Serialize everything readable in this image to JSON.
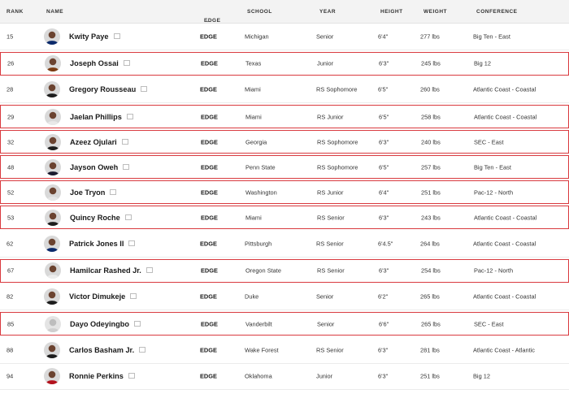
{
  "headers": {
    "rank": "RANK",
    "name": "NAME",
    "position": "EDGE",
    "school": "SCHOOL",
    "year": "YEAR",
    "height": "HEIGHT",
    "weight": "WEIGHT",
    "conference": "CONFERENCE"
  },
  "sort_icon": "chevron-down-icon",
  "highlight_color": "#d93a3f",
  "rows": [
    {
      "rank": "15",
      "name": "Kwity Paye",
      "position": "EDGE",
      "school": "Michigan",
      "year": "Senior",
      "height": "6'4\"",
      "weight": "277 lbs",
      "conference": "Big Ten - East",
      "highlighted": false,
      "jersey": "#0b2a6b"
    },
    {
      "rank": "26",
      "name": "Joseph Ossai",
      "position": "EDGE",
      "school": "Texas",
      "year": "Junior",
      "height": "6'3\"",
      "weight": "245 lbs",
      "conference": "Big 12",
      "highlighted": true,
      "jersey": "#7a3b12"
    },
    {
      "rank": "28",
      "name": "Gregory Rousseau",
      "position": "EDGE",
      "school": "Miami",
      "year": "RS Sophomore",
      "height": "6'5\"",
      "weight": "260 lbs",
      "conference": "Atlantic Coast - Coastal",
      "highlighted": false,
      "jersey": "#1d1d1d"
    },
    {
      "rank": "29",
      "name": "Jaelan Phillips",
      "position": "EDGE",
      "school": "Miami",
      "year": "RS Junior",
      "height": "6'5\"",
      "weight": "258 lbs",
      "conference": "Atlantic Coast - Coastal",
      "highlighted": true,
      "jersey": "#e9e9e9"
    },
    {
      "rank": "32",
      "name": "Azeez Ojulari",
      "position": "EDGE",
      "school": "Georgia",
      "year": "RS Sophomore",
      "height": "6'3\"",
      "weight": "240 lbs",
      "conference": "SEC - East",
      "highlighted": true,
      "jersey": "#1d1d1d"
    },
    {
      "rank": "48",
      "name": "Jayson Oweh",
      "position": "EDGE",
      "school": "Penn State",
      "year": "RS Sophomore",
      "height": "6'5\"",
      "weight": "257 lbs",
      "conference": "Big Ten - East",
      "highlighted": true,
      "jersey": "#1a1a2e"
    },
    {
      "rank": "52",
      "name": "Joe Tryon",
      "position": "EDGE",
      "school": "Washington",
      "year": "RS Junior",
      "height": "6'4\"",
      "weight": "251 lbs",
      "conference": "Pac-12 - North",
      "highlighted": true,
      "jersey": "#e6e6e6"
    },
    {
      "rank": "53",
      "name": "Quincy Roche",
      "position": "EDGE",
      "school": "Miami",
      "year": "RS Senior",
      "height": "6'3\"",
      "weight": "243 lbs",
      "conference": "Atlantic Coast - Coastal",
      "highlighted": true,
      "jersey": "#1d1d1d"
    },
    {
      "rank": "62",
      "name": "Patrick Jones II",
      "position": "EDGE",
      "school": "Pittsburgh",
      "year": "RS Senior",
      "height": "6'4.5\"",
      "weight": "264 lbs",
      "conference": "Atlantic Coast - Coastal",
      "highlighted": false,
      "jersey": "#0b2a6b"
    },
    {
      "rank": "67",
      "name": "Hamilcar Rashed Jr.",
      "position": "EDGE",
      "school": "Oregon State",
      "year": "RS Senior",
      "height": "6'3\"",
      "weight": "254 lbs",
      "conference": "Pac-12 - North",
      "highlighted": true,
      "jersey": "#ececec"
    },
    {
      "rank": "82",
      "name": "Victor Dimukeje",
      "position": "EDGE",
      "school": "Duke",
      "year": "Senior",
      "height": "6'2\"",
      "weight": "265 lbs",
      "conference": "Atlantic Coast - Coastal",
      "highlighted": false,
      "jersey": "#1d1d1d"
    },
    {
      "rank": "85",
      "name": "Dayo Odeyingbo",
      "position": "EDGE",
      "school": "Vanderbilt",
      "year": "Senior",
      "height": "6'6\"",
      "weight": "265 lbs",
      "conference": "SEC - East",
      "highlighted": true,
      "jersey": "#cfcfcf",
      "placeholder": true
    },
    {
      "rank": "88",
      "name": "Carlos Basham Jr.",
      "position": "EDGE",
      "school": "Wake Forest",
      "year": "RS Senior",
      "height": "6'3\"",
      "weight": "281 lbs",
      "conference": "Atlantic Coast - Atlantic",
      "highlighted": false,
      "jersey": "#1d1d1d"
    },
    {
      "rank": "94",
      "name": "Ronnie Perkins",
      "position": "EDGE",
      "school": "Oklahoma",
      "year": "Junior",
      "height": "6'3\"",
      "weight": "251 lbs",
      "conference": "Big 12",
      "highlighted": false,
      "jersey": "#b3121d"
    }
  ]
}
